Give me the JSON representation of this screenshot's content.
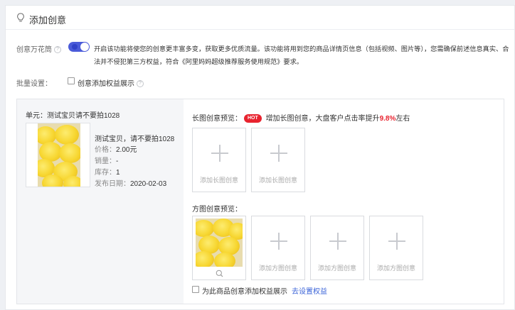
{
  "header": {
    "title": "添加创意",
    "icon": "lightbulb-icon"
  },
  "creative_switch": {
    "label": "创意万花筒",
    "enabled": true,
    "description": "开启该功能将使您的创意更丰富多变，获取更多优质流量。该功能将用到您的商品详情页信息（包括视频、图片等），您需确保前述信息真实、合法并不侵犯第三方权益，符合《阿里妈妈超级推荐服务使用规范》要求。"
  },
  "batch": {
    "label": "批量设置：",
    "checkbox_label": "创意添加权益展示"
  },
  "unit": {
    "title": "单元：测试宝贝请不要拍1028",
    "product_name": "测试宝贝，请不要拍1028",
    "price_label": "价格：",
    "price": "2.00元",
    "sales_label": "销量：",
    "sales": "-",
    "stock_label": "库存：",
    "stock": "1",
    "date_label": "发布日期：",
    "date": "2020-02-03"
  },
  "long_preview": {
    "title": "长图创意预览：",
    "badge": "HOT",
    "promo_prefix": "增加长图创意，大盘客户点击率提升",
    "promo_value": "9.8%",
    "promo_suffix": "左右",
    "slots": [
      "添加长图创意",
      "添加长图创意"
    ]
  },
  "square_preview": {
    "title": "方图创意预览：",
    "slots": [
      "添加方图创意",
      "添加方图创意",
      "添加方图创意"
    ]
  },
  "footer": {
    "checkbox_label": "为此商品创意添加权益展示",
    "link": "去设置权益"
  },
  "colors": {
    "accent": "#4a5bd9",
    "hot": "#e8232f",
    "link": "#3a63d8"
  }
}
